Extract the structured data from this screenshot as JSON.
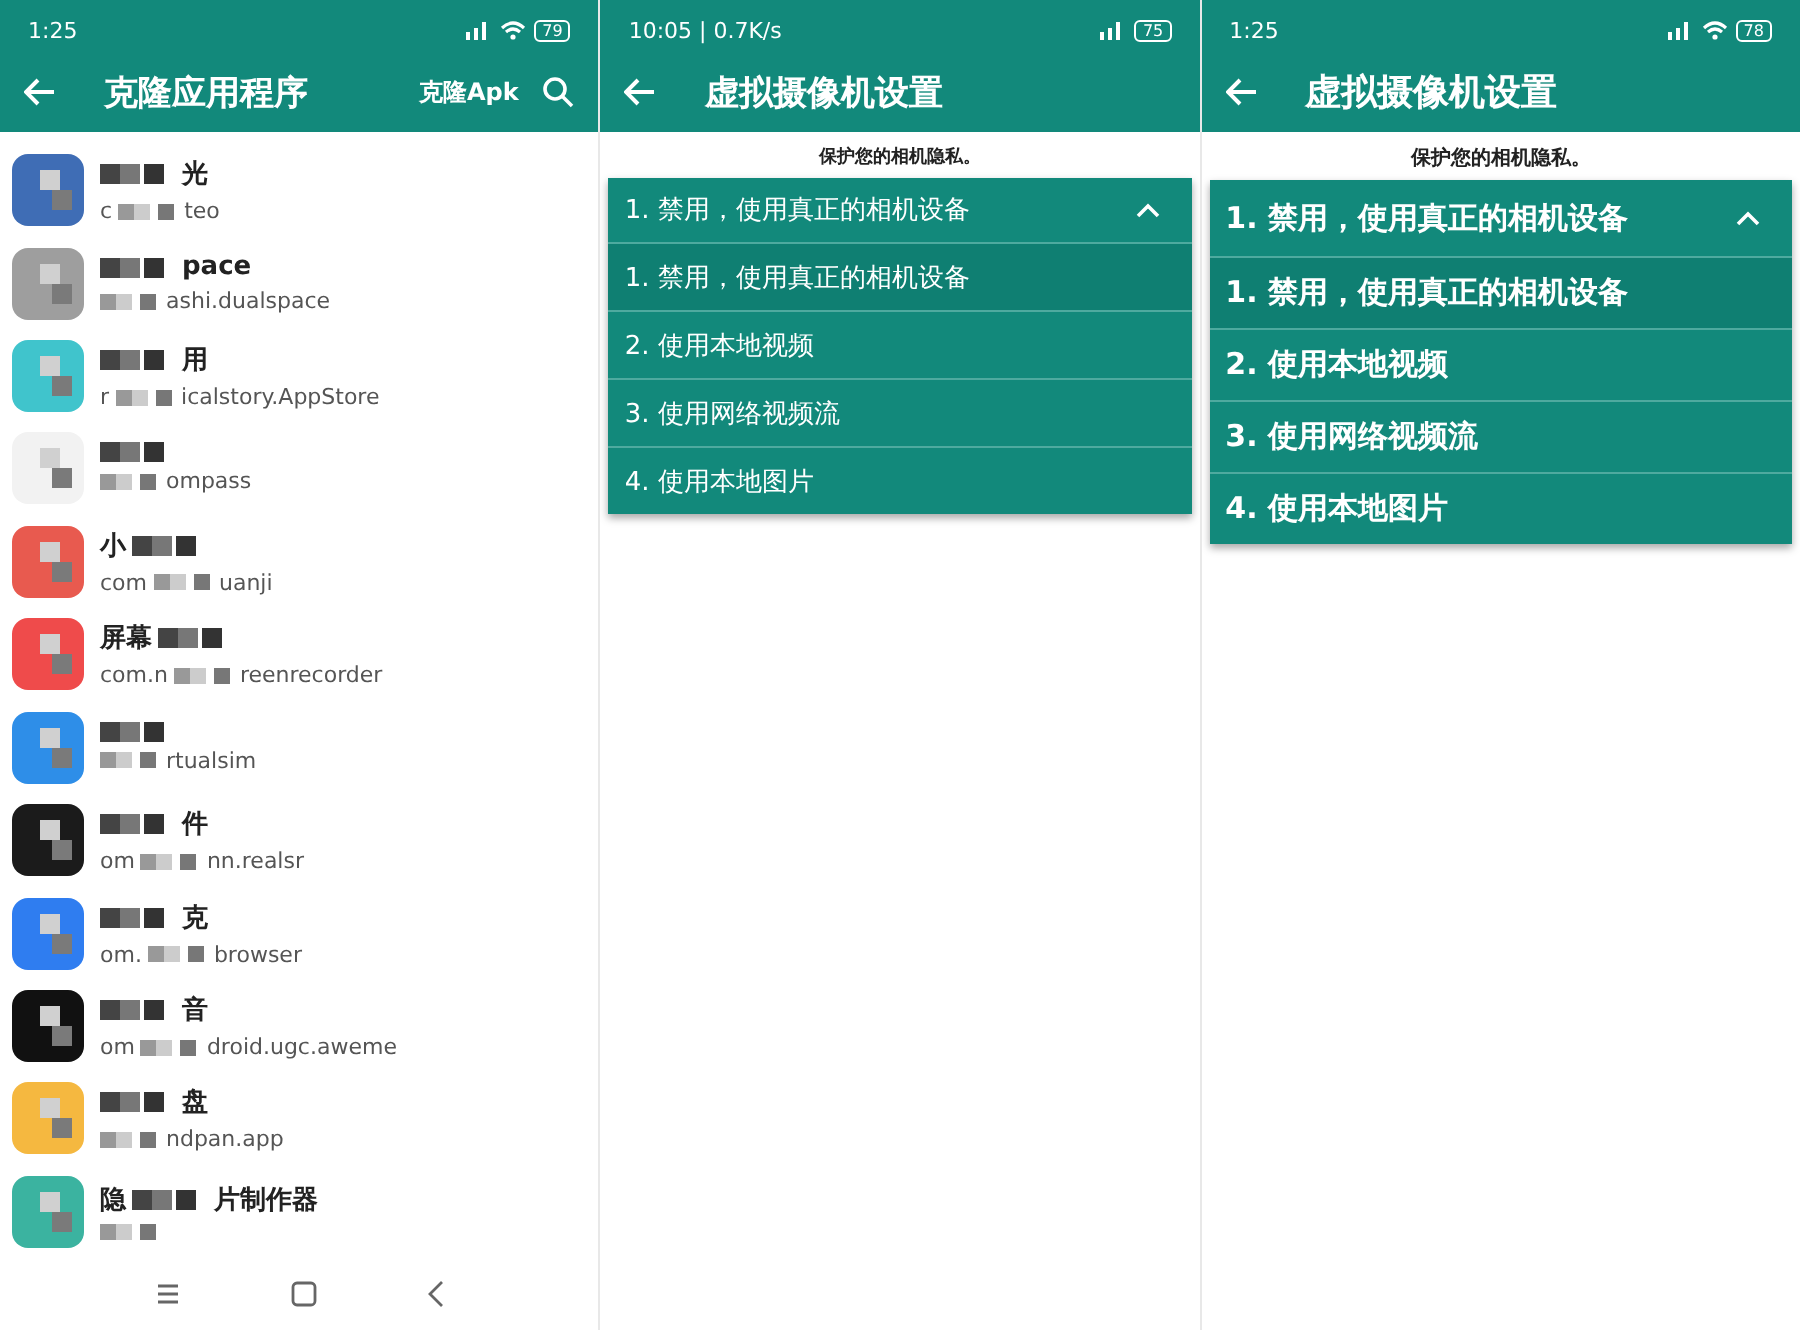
{
  "panels": [
    {
      "kind": "app_list",
      "status_bar": {
        "time": "1:25",
        "battery": "79",
        "wifi": true
      },
      "toolbar": {
        "title": "克隆应用程序",
        "action": "克隆Apk"
      },
      "apps": [
        {
          "name": "光",
          "package_prefix": "c",
          "package": "teo",
          "color": "#3f6db5"
        },
        {
          "name": "pace",
          "package": "ashi.dualspace",
          "color": "#9e9e9e"
        },
        {
          "name": "用",
          "package_prefix": "r",
          "package": "icalstory.AppStore",
          "color": "#40c4cc"
        },
        {
          "package": "ompass",
          "color": "#f2f2f2"
        },
        {
          "name_prefix": "小",
          "package_prefix": "com",
          "package": "uanji",
          "color": "#e85a4f"
        },
        {
          "name_prefix": "屏幕",
          "package_prefix": "com.n",
          "package": "reenrecorder",
          "color": "#ef4b4b"
        },
        {
          "package": "rtualsim",
          "color": "#2e8ee8"
        },
        {
          "name": "件",
          "package_prefix": "om",
          "package": "nn.realsr",
          "color": "#1b1b1b"
        },
        {
          "name": "克",
          "package_prefix": "om.",
          "package": "browser",
          "color": "#2f7df0"
        },
        {
          "name": "音",
          "package_prefix": "om",
          "package": "droid.ugc.aweme",
          "color": "#111111"
        },
        {
          "name": "盘",
          "package": "ndpan.app",
          "color": "#f5b840"
        },
        {
          "name_prefix": "隐",
          "name": "片制作器",
          "color": "#3bb3a0"
        }
      ]
    },
    {
      "kind": "compact_settings",
      "status_bar": {
        "time": "10:05 | 0.7K/s",
        "battery": "75",
        "wifi": false
      },
      "toolbar": {
        "title": "虚拟摄像机设置"
      },
      "subtitle": "保护您的相机隐私。",
      "dropdown": {
        "value": "1. 禁用，使用真正的相机设备",
        "expanded": true,
        "options": [
          {
            "label": "1. 禁用，使用真正的相机设备",
            "selected": true
          },
          {
            "label": "2. 使用本地视频",
            "selected": false
          },
          {
            "label": "3. 使用网络视频流",
            "selected": false
          },
          {
            "label": "4. 使用本地图片",
            "selected": false
          }
        ]
      }
    },
    {
      "kind": "settings",
      "status_bar": {
        "time": "1:25",
        "battery": "78",
        "wifi": true
      },
      "toolbar": {
        "title": "虚拟摄像机设置"
      },
      "subtitle": "保护您的相机隐私。",
      "dropdown": {
        "value": "1. 禁用，使用真正的相机设备",
        "expanded": true,
        "options": [
          {
            "label": "1. 禁用，使用真正的相机设备",
            "selected": true
          },
          {
            "label": "2. 使用本地视频",
            "selected": false
          },
          {
            "label": "3. 使用网络视频流",
            "selected": false
          },
          {
            "label": "4. 使用本地图片",
            "selected": false
          }
        ]
      }
    }
  ]
}
